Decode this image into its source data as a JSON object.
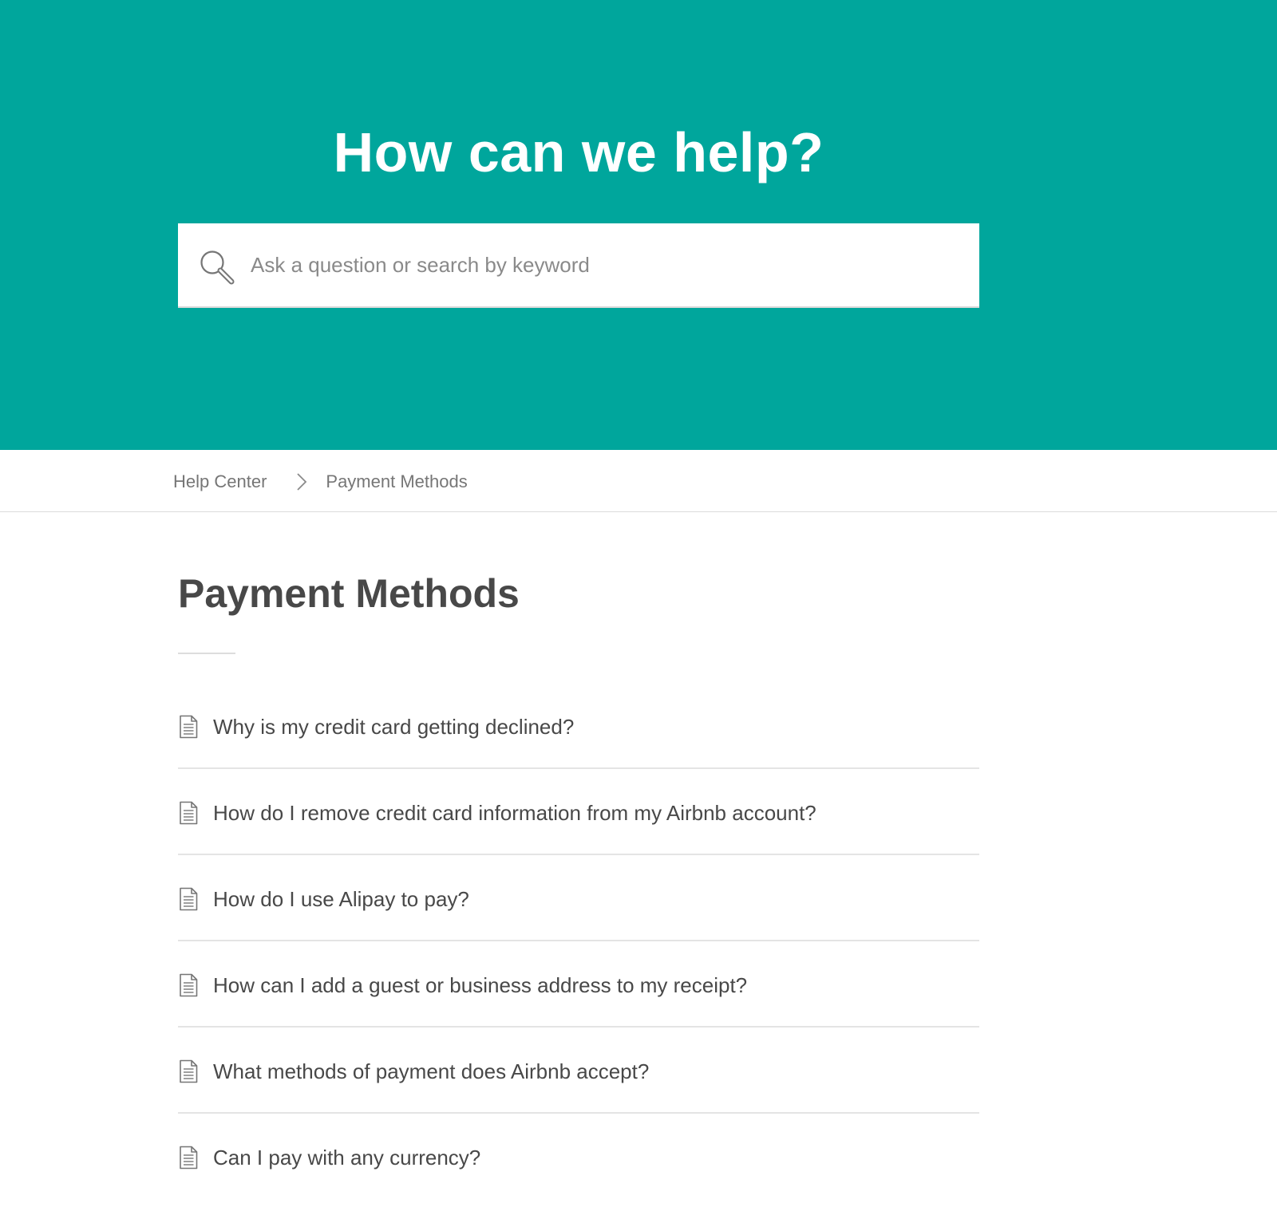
{
  "hero": {
    "title": "How can we help?",
    "background_color": "#00a69c"
  },
  "search": {
    "icon": "search-icon",
    "placeholder": "Ask a question or search by keyword",
    "value": ""
  },
  "breadcrumb": {
    "items": [
      {
        "label": "Help Center"
      },
      {
        "label": "Payment Methods"
      }
    ],
    "separator_icon": "chevron-right-icon"
  },
  "page": {
    "title": "Payment Methods"
  },
  "articles": {
    "icon": "document-icon",
    "items": [
      {
        "label": "Why is my credit card getting declined?"
      },
      {
        "label": "How do I remove credit card information from my Airbnb account?"
      },
      {
        "label": "How do I use Alipay to pay?"
      },
      {
        "label": "How can I add a guest or business address to my receipt?"
      },
      {
        "label": "What methods of payment does Airbnb accept?"
      },
      {
        "label": "Can I pay with any currency?"
      }
    ]
  }
}
